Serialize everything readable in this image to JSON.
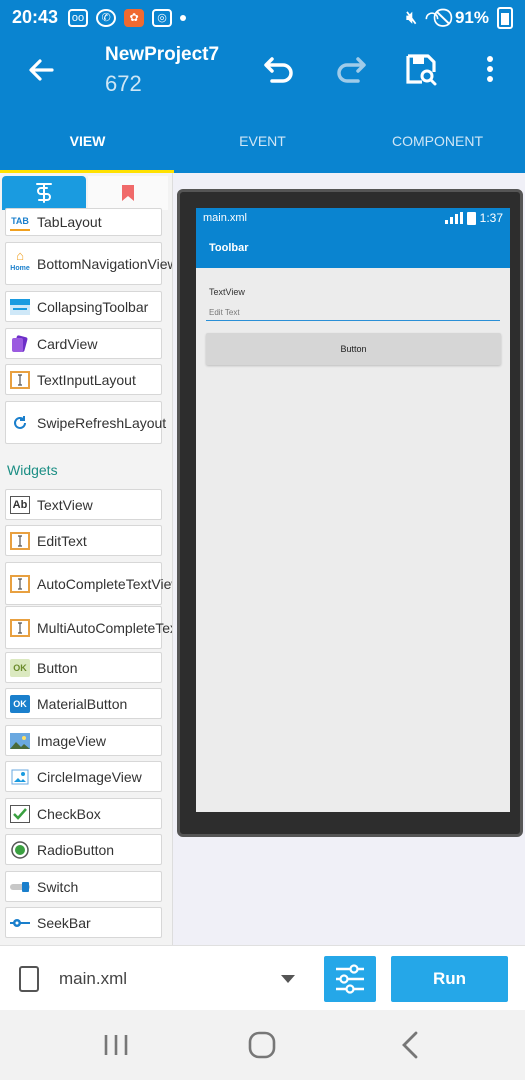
{
  "status_bar": {
    "time": "20:43",
    "battery": "91%"
  },
  "app_bar": {
    "title": "NewProject7",
    "subtitle": "672"
  },
  "tabs": [
    {
      "label": "VIEW",
      "active": true
    },
    {
      "label": "EVENT",
      "active": false
    },
    {
      "label": "COMPONENT",
      "active": false
    }
  ],
  "palette": {
    "layouts": [
      {
        "label": "TabLayout",
        "icon": "tab-layout-icon"
      },
      {
        "label": "BottomNavigationView",
        "icon": "home-icon"
      },
      {
        "label": "CollapsingToolbar",
        "icon": "collapsing-toolbar-icon"
      },
      {
        "label": "CardView",
        "icon": "card-icon"
      },
      {
        "label": "TextInputLayout",
        "icon": "text-input-icon"
      },
      {
        "label": "SwipeRefreshLayout",
        "icon": "refresh-icon"
      }
    ],
    "section_widgets": "Widgets",
    "widgets": [
      {
        "label": "TextView",
        "icon": "textview-icon"
      },
      {
        "label": "EditText",
        "icon": "edittext-icon"
      },
      {
        "label": "AutoCompleteTextView",
        "icon": "autocomplete-icon"
      },
      {
        "label": "MultiAutoCompleteTextView",
        "icon": "multi-autocomplete-icon"
      },
      {
        "label": "Button",
        "icon": "button-icon"
      },
      {
        "label": "MaterialButton",
        "icon": "material-button-icon"
      },
      {
        "label": "ImageView",
        "icon": "image-icon"
      },
      {
        "label": "CircleImageView",
        "icon": "circle-image-icon"
      },
      {
        "label": "CheckBox",
        "icon": "checkbox-icon"
      },
      {
        "label": "RadioButton",
        "icon": "radio-icon"
      },
      {
        "label": "Switch",
        "icon": "switch-icon"
      },
      {
        "label": "SeekBar",
        "icon": "seekbar-icon"
      }
    ],
    "icon_text": {
      "tab": "TAB",
      "home": "Home",
      "ab": "Ab",
      "ok": "OK"
    }
  },
  "preview": {
    "status_file": "main.xml",
    "status_time": "1:37",
    "toolbar": "Toolbar",
    "textview": "TextView",
    "edittext_hint": "Edit Text",
    "button": "Button"
  },
  "bottom": {
    "file": "main.xml",
    "run": "Run"
  },
  "colors": {
    "primary": "#0a84d0",
    "accent": "#25a7e8",
    "indicator": "#ffe100",
    "section": "#1b8e84"
  }
}
